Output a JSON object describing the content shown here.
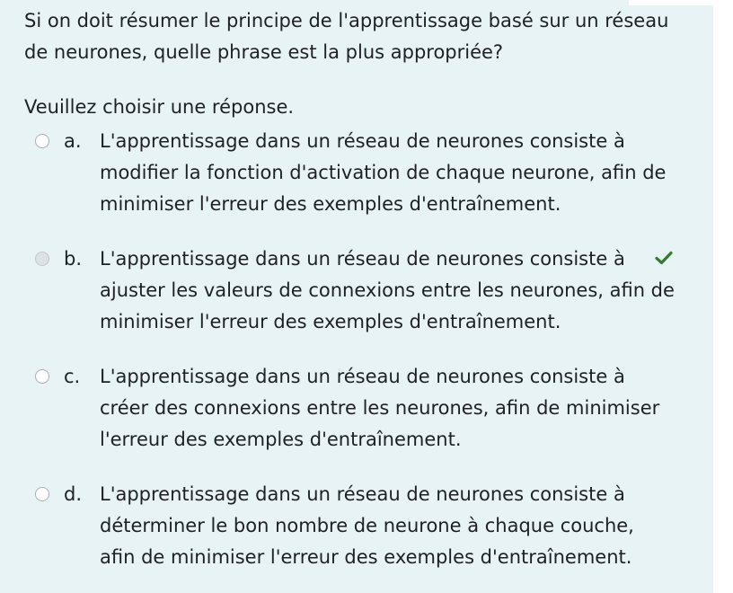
{
  "question": {
    "text": "Si on doit résumer le principe de l'apprentissage basé sur un réseau de neurones, quelle phrase est la plus appropriée?",
    "prompt": "Veuillez choisir une réponse."
  },
  "answers": [
    {
      "letter": "a.",
      "text": "L'apprentissage dans un réseau de neurones consiste à modifier la fonction d'activation de chaque neurone, afin de minimiser l'erreur des exemples d'entraînement.",
      "selected": false
    },
    {
      "letter": "b.",
      "text": "L'apprentissage dans un réseau de neurones consiste à ajuster les valeurs de connexions entre les neurones, afin de minimiser l'erreur des exemples d'entraînement.",
      "selected": true,
      "correct_icon": "check-icon"
    },
    {
      "letter": "c.",
      "text": "L'apprentissage dans un réseau de neurones consiste à créer des connexions entre les neurones, afin de minimiser l'erreur des exemples d'entraînement.",
      "selected": false
    },
    {
      "letter": "d.",
      "text": "L'apprentissage dans un réseau de neurones consiste à déterminer le bon nombre de neurone à chaque couche, afin de minimiser l'erreur des exemples d'entraînement.",
      "selected": false
    }
  ],
  "colors": {
    "panel_background": "#e7f3f5",
    "text": "#1d2125",
    "correct": "#357a32"
  }
}
